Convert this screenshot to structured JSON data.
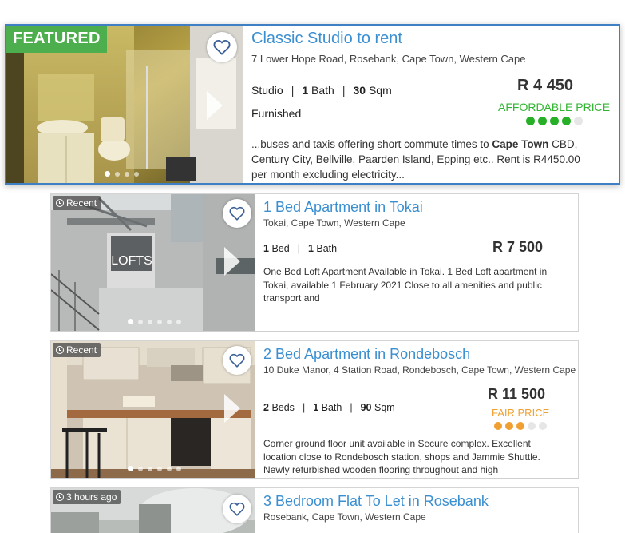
{
  "colors": {
    "title_blue": "#3a8fd1",
    "featured_green": "#4cae4c",
    "affordable_green": "#2fb52f",
    "fair_orange": "#f0a030",
    "dot_off": "#e6e6e6",
    "featured_border": "#3f7fc4"
  },
  "listings": [
    {
      "badge": "FEATURED",
      "favorite_icon": "heart-icon",
      "title": "Classic Studio to rent",
      "address": "7 Lower Hope Road, Rosebank, Cape Town, Western Cape",
      "type": "Studio",
      "baths": "1",
      "baths_label": "Bath",
      "size": "30",
      "size_label": "Sqm",
      "furnished": "Furnished",
      "price": "R 4 450",
      "rating_label": "AFFORDABLE PRICE",
      "rating_filled": 4,
      "rating_total": 5,
      "description_pre": "...buses and taxis offering short commute times to ",
      "description_bold": "Cape Town",
      "description_post": " CBD, Century City, Bellville, Paarden Island, Epping etc.. Rent is R4450.00 per month excluding electricity...",
      "photo_count": 4,
      "photo_active": 1
    },
    {
      "badge": "Recent",
      "favorite_icon": "heart-icon",
      "title": "1 Bed Apartment in Tokai",
      "address": "Tokai, Cape Town, Western Cape",
      "beds": "1",
      "beds_label": "Bed",
      "baths": "1",
      "baths_label": "Bath",
      "price": "R 7 500",
      "description": "One Bed Loft Apartment Available in Tokai. 1 Bed Loft apartment in Tokai, available 1 February 2021 Close to all amenities and public transport and",
      "photo_sign": "LOFTS",
      "photo_count": 6,
      "photo_active": 1
    },
    {
      "badge": "Recent",
      "favorite_icon": "heart-icon",
      "title": "2 Bed Apartment in Rondebosch",
      "address": "10 Duke Manor, 4 Station Road, Rondebosch, Cape Town, Western Cape",
      "beds": "2",
      "beds_label": "Beds",
      "baths": "1",
      "baths_label": "Bath",
      "size": "90",
      "size_label": "Sqm",
      "price": "R 11 500",
      "rating_label": "FAIR PRICE",
      "rating_filled": 3,
      "rating_total": 5,
      "description": "Corner ground floor unit available in Secure complex. Excellent location close to Rondebosch station, shops and Jammie Shuttle. Newly refurbished wooden flooring throughout and high",
      "photo_count": 6,
      "photo_active": 1
    },
    {
      "badge": "3 hours ago",
      "favorite_icon": "heart-icon",
      "title": "3 Bedroom Flat To Let in Rosebank",
      "address": "Rosebank, Cape Town, Western Cape"
    }
  ]
}
